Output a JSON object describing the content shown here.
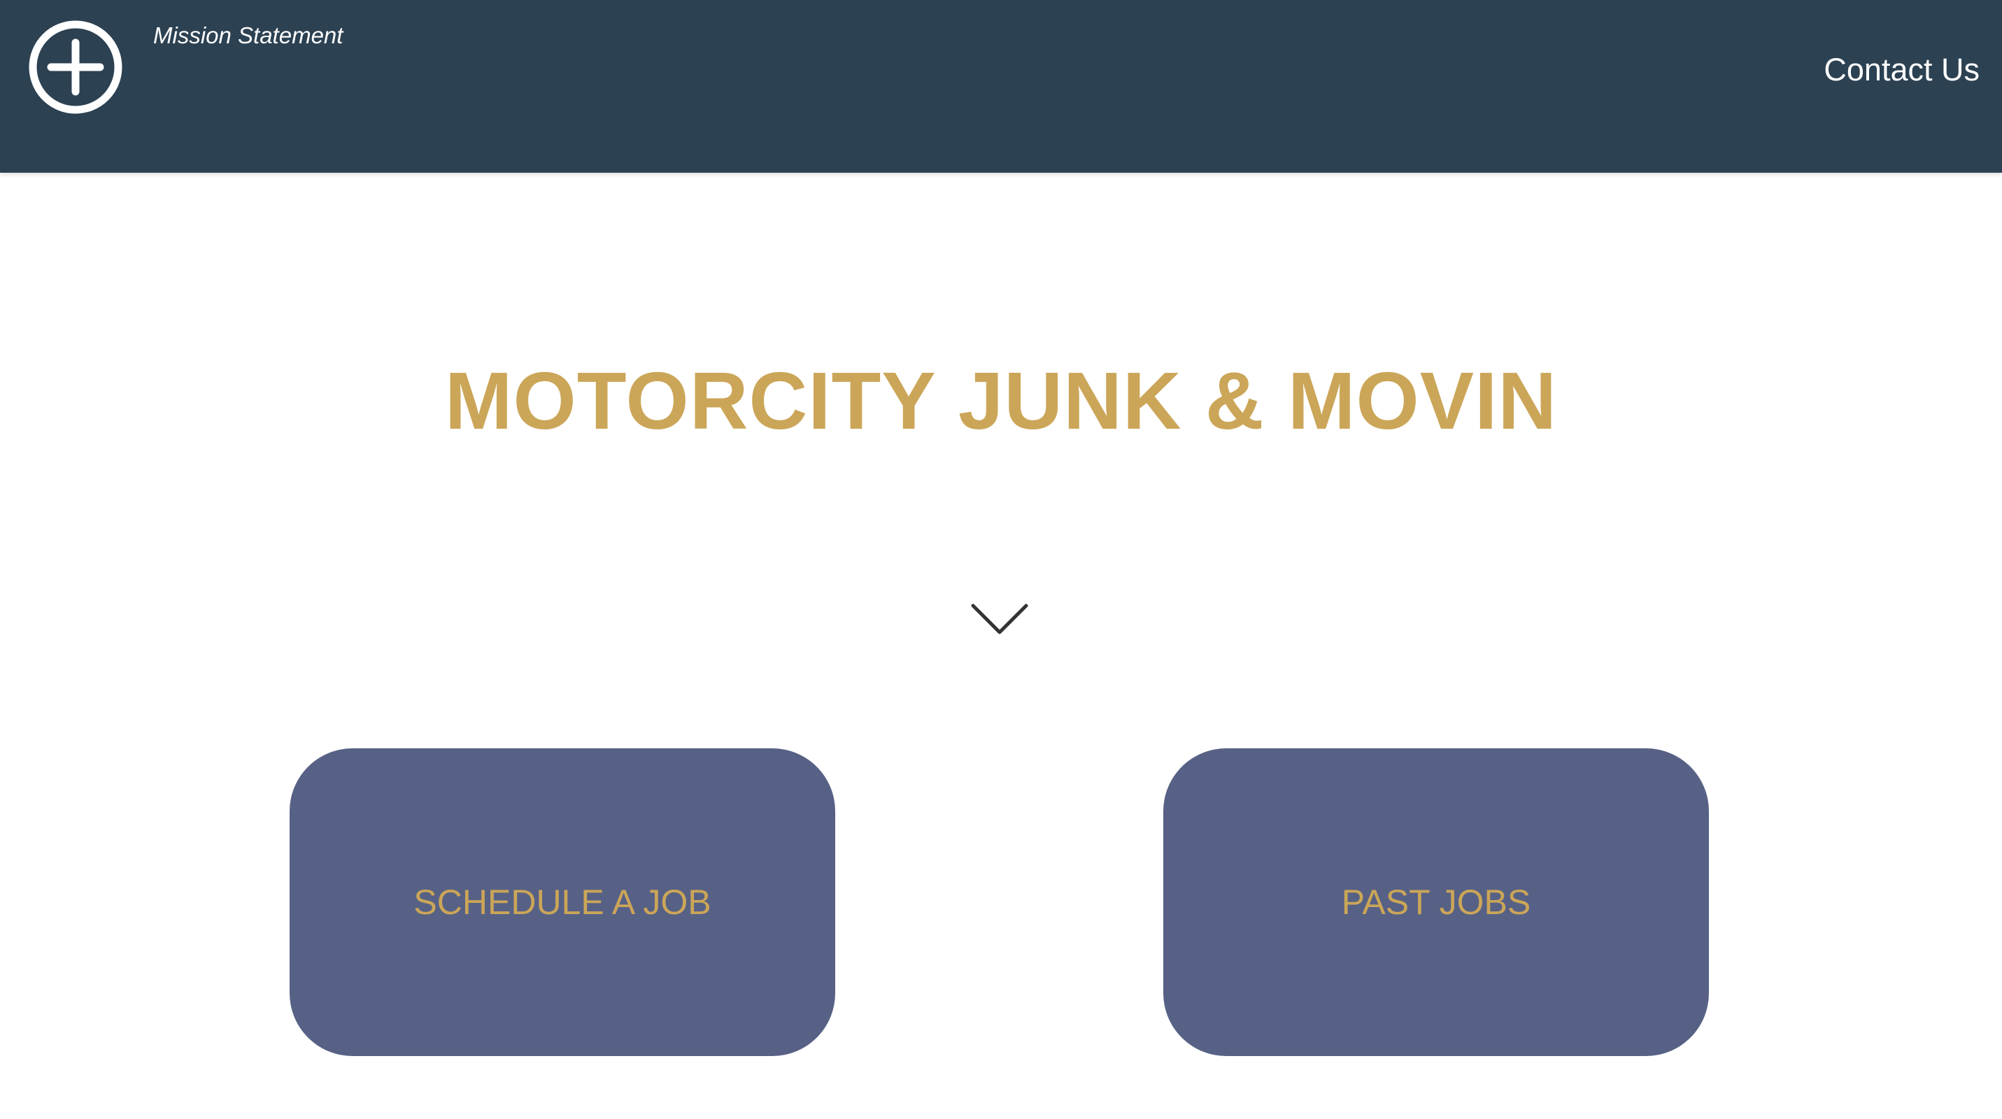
{
  "header": {
    "logo_icon": "plus-circle-icon",
    "mission_label": "Mission Statement",
    "contact_label": "Contact Us",
    "background_color": "#2c4152"
  },
  "hero": {
    "title": "MOTORCITY JUNK & MOVIN",
    "title_color": "#cba658",
    "scroll_icon": "chevron-down-icon"
  },
  "actions": {
    "schedule_label": "SCHEDULE A JOB",
    "past_jobs_label": "PAST JOBS",
    "button_color": "#576185",
    "label_color": "#cba658"
  }
}
